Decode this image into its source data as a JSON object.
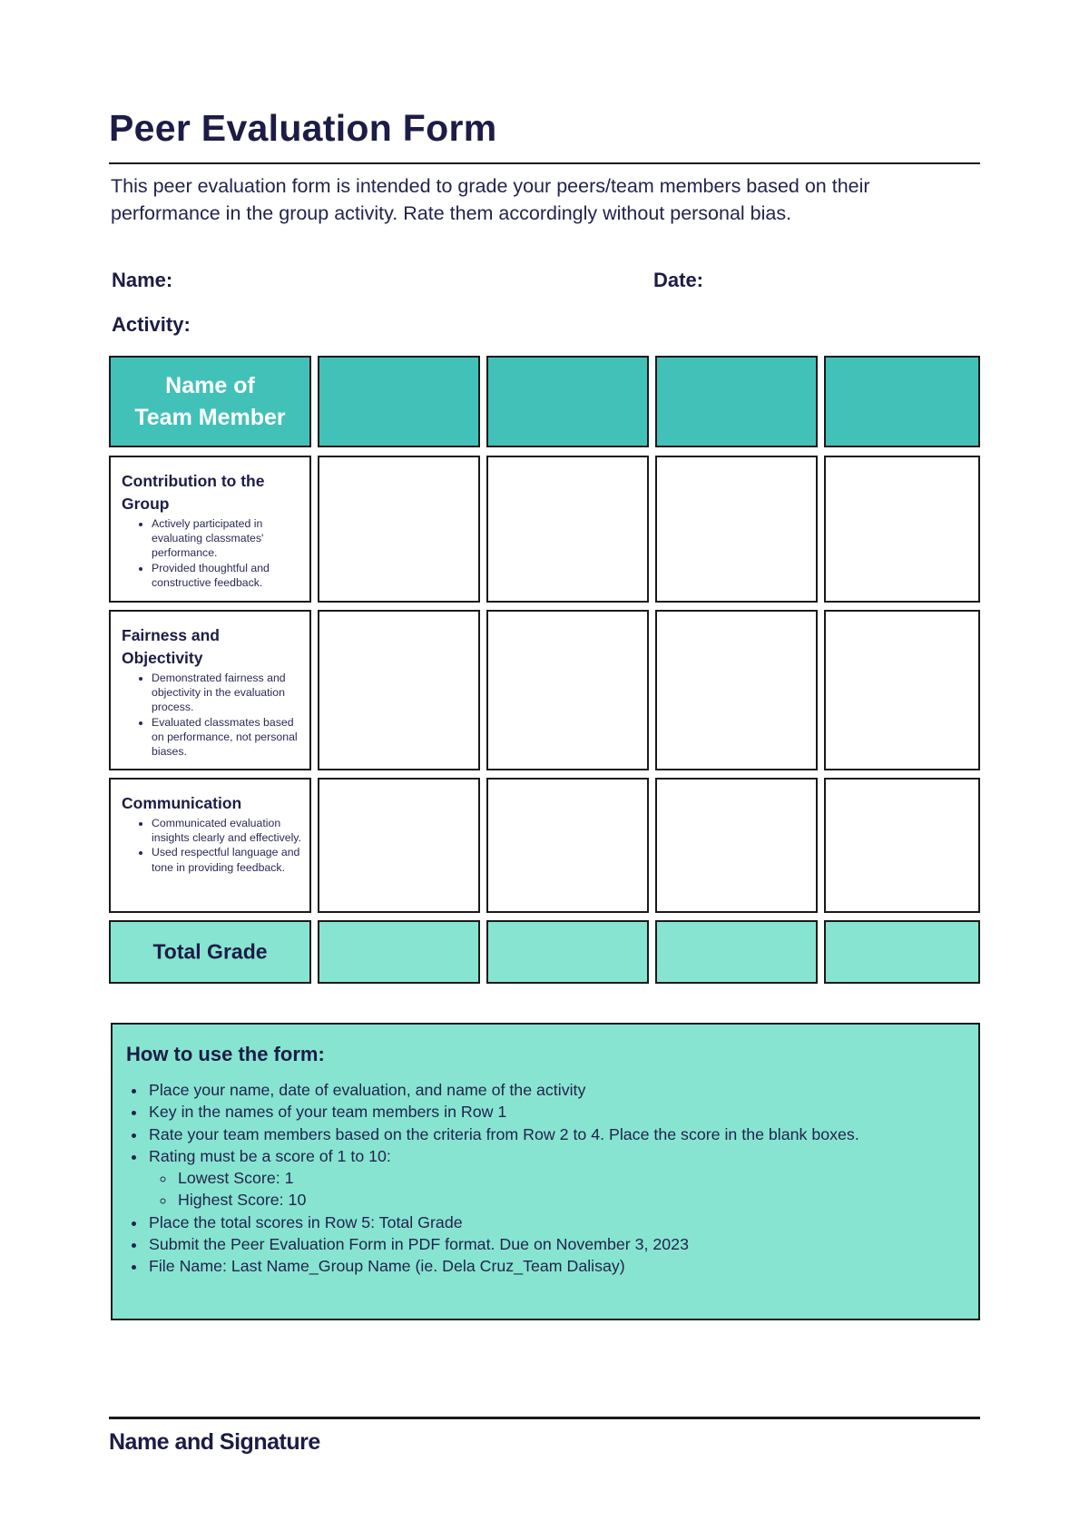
{
  "document": {
    "title": "Peer Evaluation Form",
    "intro": "This peer evaluation form is intended to grade your peers/team members based on their performance in the group activity. Rate them accordingly without personal bias."
  },
  "fields": {
    "name_label": "Name:",
    "date_label": "Date:",
    "activity_label": "Activity:"
  },
  "table": {
    "header_label_line1": "Name of",
    "header_label_line2": "Team Member",
    "team_member_columns": 4,
    "criteria": [
      {
        "title": "Contribution to the Group",
        "bullets": [
          "Actively participated in evaluating classmates' performance.",
          "Provided thoughtful and constructive feedback."
        ]
      },
      {
        "title": "Fairness and Objectivity",
        "bullets": [
          "Demonstrated fairness and objectivity in the evaluation process.",
          "Evaluated classmates based on performance, not personal biases."
        ]
      },
      {
        "title": "Communication",
        "bullets": [
          "Communicated evaluation insights clearly and effectively.",
          "Used respectful language and tone in providing feedback."
        ]
      }
    ],
    "total_label": "Total Grade"
  },
  "instructions": {
    "title": "How to use the form:",
    "items": [
      "Place your name, date of evaluation, and name of the activity",
      "Key in the names of your team members in Row 1",
      "Rate your team members based on the criteria from Row 2 to 4. Place the score in the blank boxes.",
      "Rating must be a score of 1 to 10:",
      "Place the total scores in Row 5: Total Grade",
      "Submit the Peer Evaluation Form in PDF format. Due on November 3, 2023",
      "File Name: Last Name_Group Name (ie. Dela Cruz_Team Dalisay)"
    ],
    "sub_items": [
      "Lowest Score: 1",
      "Highest Score: 10"
    ]
  },
  "signature": {
    "label": "Name and Signature"
  },
  "colors": {
    "header_teal": "#42c1b9",
    "total_mint": "#87e4d0",
    "text_navy": "#1c1c46"
  }
}
